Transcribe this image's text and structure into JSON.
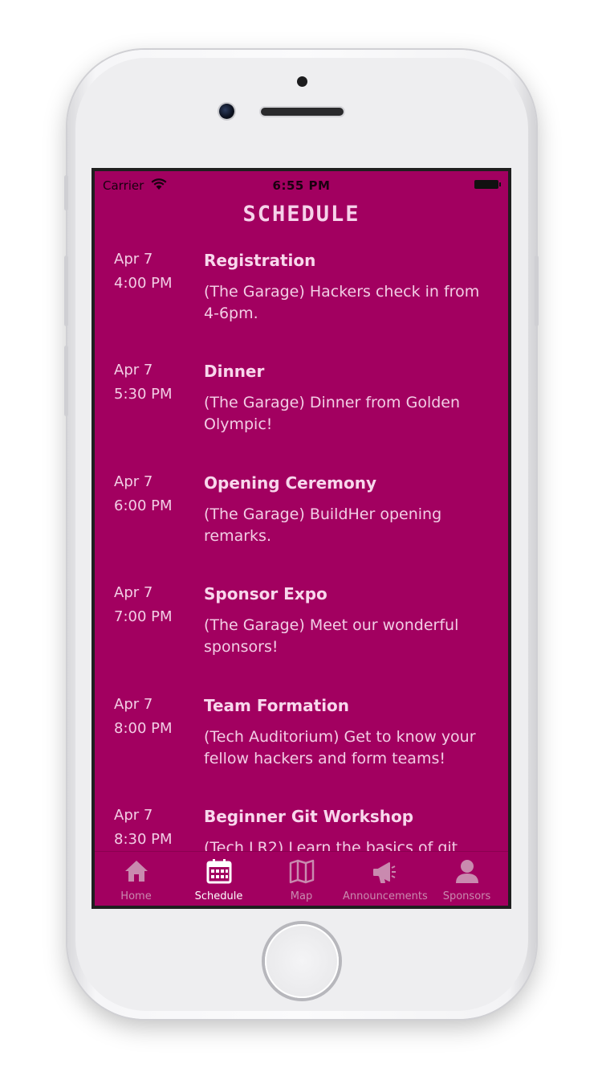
{
  "status_bar": {
    "carrier": "Carrier",
    "time": "6:55 PM"
  },
  "header": {
    "title": "SCHEDULE"
  },
  "schedule": [
    {
      "date": "Apr 7",
      "time": "4:00 PM",
      "title": "Registration",
      "description": "(The Garage) Hackers check in from 4-6pm."
    },
    {
      "date": "Apr 7",
      "time": "5:30 PM",
      "title": "Dinner",
      "description": "(The Garage) Dinner from Golden Olympic!"
    },
    {
      "date": "Apr 7",
      "time": "6:00 PM",
      "title": "Opening Ceremony",
      "description": "(The Garage) BuildHer opening remarks."
    },
    {
      "date": "Apr 7",
      "time": "7:00 PM",
      "title": "Sponsor Expo",
      "description": "(The Garage) Meet our wonderful sponsors!"
    },
    {
      "date": "Apr 7",
      "time": "8:00 PM",
      "title": "Team Formation",
      "description": "(Tech Auditorium) Get to know your fellow hackers and form teams!"
    },
    {
      "date": "Apr 7",
      "time": "8:30 PM",
      "title": "Beginner Git Workshop",
      "description": "(Tech LR2) Learn the basics of git"
    }
  ],
  "tab_bar": {
    "tabs": [
      {
        "label": "Home",
        "icon": "home-icon",
        "active": false
      },
      {
        "label": "Schedule",
        "icon": "calendar-icon",
        "active": true
      },
      {
        "label": "Map",
        "icon": "map-icon",
        "active": false
      },
      {
        "label": "Announcements",
        "icon": "megaphone-icon",
        "active": false
      },
      {
        "label": "Sponsors",
        "icon": "person-icon",
        "active": false
      }
    ]
  },
  "colors": {
    "background": "#a20060",
    "text": "#f2cde5",
    "tab_inactive": "#c98aaf",
    "tab_active": "#ffffff"
  }
}
